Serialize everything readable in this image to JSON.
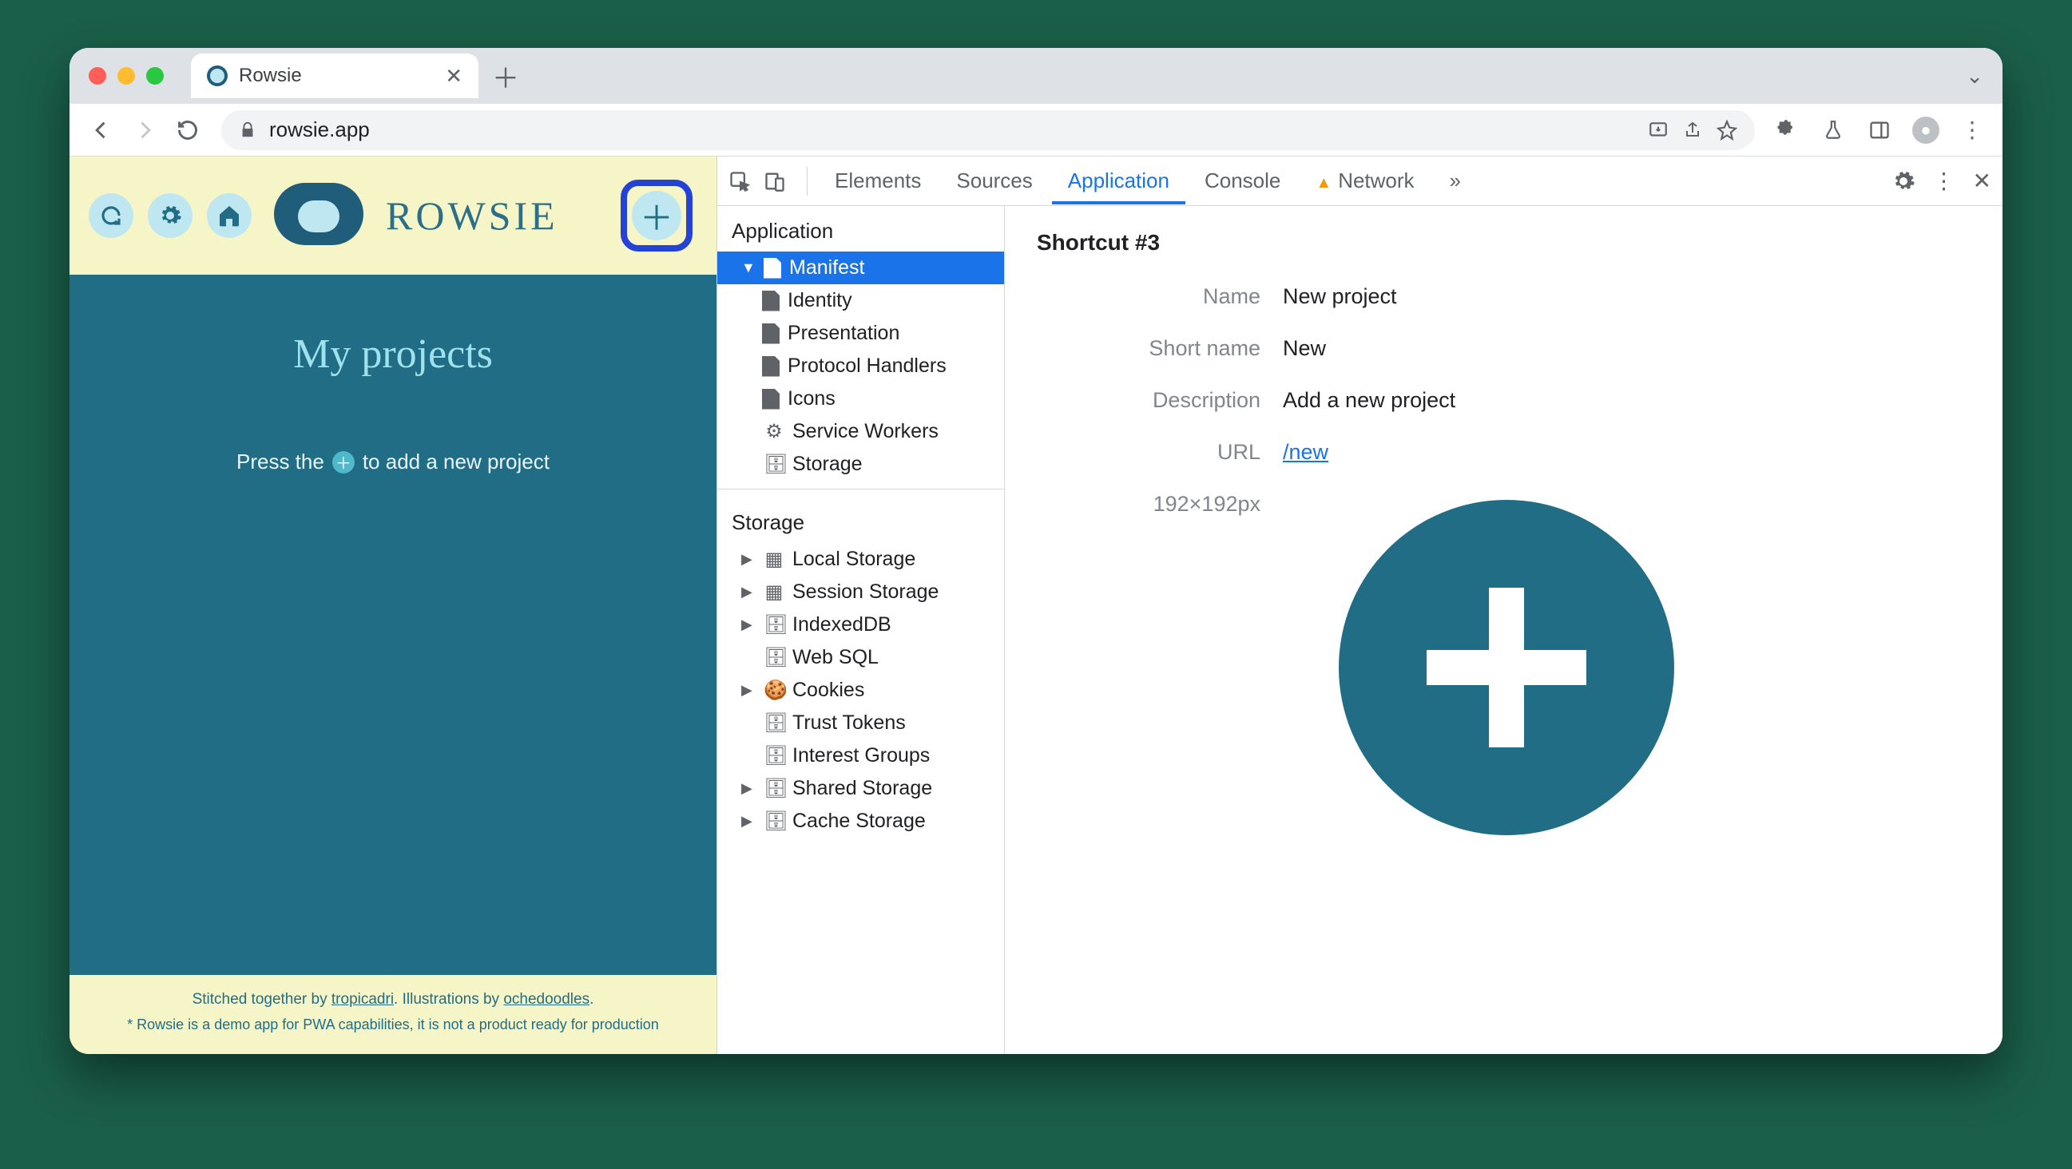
{
  "browser": {
    "tab_title": "Rowsie",
    "url": "rowsie.app"
  },
  "app": {
    "logo_text": "ROWSIE",
    "heading": "My projects",
    "hint_pre": "Press the",
    "hint_post": "to add a new project",
    "footer_text_1a": "Stitched together by ",
    "footer_link_1": "tropicadri",
    "footer_text_1b": ". Illustrations by ",
    "footer_link_2": "ochedoodles",
    "footer_text_1c": ".",
    "footer_note": "* Rowsie is a demo app for PWA capabilities, it is not a product ready for production"
  },
  "devtools": {
    "tabs": {
      "elements": "Elements",
      "sources": "Sources",
      "application": "Application",
      "console": "Console",
      "network": "Network"
    },
    "sidebar": {
      "sec1_title": "Application",
      "manifest": "Manifest",
      "identity": "Identity",
      "presentation": "Presentation",
      "protocol": "Protocol Handlers",
      "icons": "Icons",
      "service_workers": "Service Workers",
      "storage_item": "Storage",
      "sec2_title": "Storage",
      "local_storage": "Local Storage",
      "session_storage": "Session Storage",
      "indexeddb": "IndexedDB",
      "websql": "Web SQL",
      "cookies": "Cookies",
      "trust_tokens": "Trust Tokens",
      "interest_groups": "Interest Groups",
      "shared_storage": "Shared Storage",
      "cache_storage": "Cache Storage"
    },
    "details": {
      "title": "Shortcut #3",
      "name_k": "Name",
      "name_v": "New project",
      "short_k": "Short name",
      "short_v": "New",
      "desc_k": "Description",
      "desc_v": "Add a new project",
      "url_k": "URL",
      "url_v": "/new",
      "size": "192×192px"
    }
  }
}
